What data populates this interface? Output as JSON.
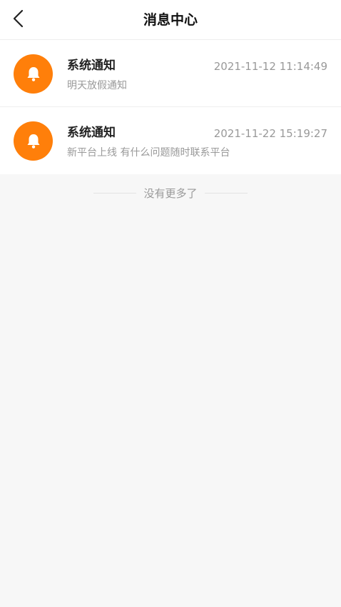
{
  "header": {
    "title": "消息中心",
    "back_icon": "chevron-left-icon"
  },
  "messages": [
    {
      "icon": "bell-icon",
      "title": "系统通知",
      "time": "2021-11-12 11:14:49",
      "body": "明天放假通知"
    },
    {
      "icon": "bell-icon",
      "title": "系统通知",
      "time": "2021-11-22 15:19:27",
      "body": "新平台上线 有什么问题随时联系平台"
    }
  ],
  "footer": {
    "no_more_text": "没有更多了"
  },
  "colors": {
    "accent": "#ff7f0a",
    "background": "#f7f7f7",
    "secondary_text": "#999999"
  }
}
